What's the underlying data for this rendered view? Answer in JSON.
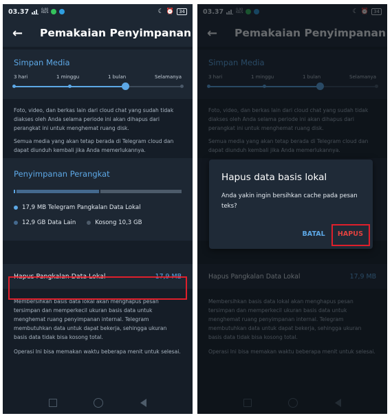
{
  "status": {
    "time": "03.37",
    "net_top": "0,00",
    "net_bottom": "KB/S",
    "battery": "34"
  },
  "appbar": {
    "title": "Pemakaian Penyimpanan"
  },
  "media": {
    "title": "Simpan Media",
    "options": [
      "3 hari",
      "1 minggu",
      "1 bulan",
      "Selamanya"
    ],
    "selected_index": 2,
    "hint1": "Foto, video, dan berkas lain dari cloud chat yang sudah tidak diakses oleh Anda selama periode ini akan dihapus dari perangkat ini untuk menghemat ruang disk.",
    "hint2": "Semua media yang akan tetap berada di Telegram cloud dan dapat diunduh kembali jika Anda memerlukannya."
  },
  "device": {
    "title": "Penyimpanan Perangkat",
    "legend_local": "17,9 MB Telegram Pangkalan Data Lokal",
    "legend_other": "12,9 GB Data Lain",
    "legend_free": "Kosong 10,3 GB",
    "colors": {
      "local": "#5da8e6",
      "other": "#44698e",
      "free": "#4d5b6a"
    }
  },
  "clear": {
    "label": "Hapus Pangkalan Data Lokal",
    "size": "17,9 MB",
    "hint1": "Membersihkan basis data lokal akan menghapus pesan tersimpan dan memperkecil ukuran basis data untuk menghemat ruang penyimpanan internal. Telegram membutuhkan data untuk dapat bekerja, sehingga ukuran basis data tidak bisa kosong total.",
    "hint2": "Operasi Ini bisa memakan waktu beberapa menit untuk selesai."
  },
  "dialog": {
    "title": "Hapus data basis lokal",
    "message": "Anda yakin ingin bersihkan cache pada pesan teks?",
    "cancel": "BATAL",
    "confirm": "HAPUS"
  },
  "highlight_color": "#e01f2b"
}
